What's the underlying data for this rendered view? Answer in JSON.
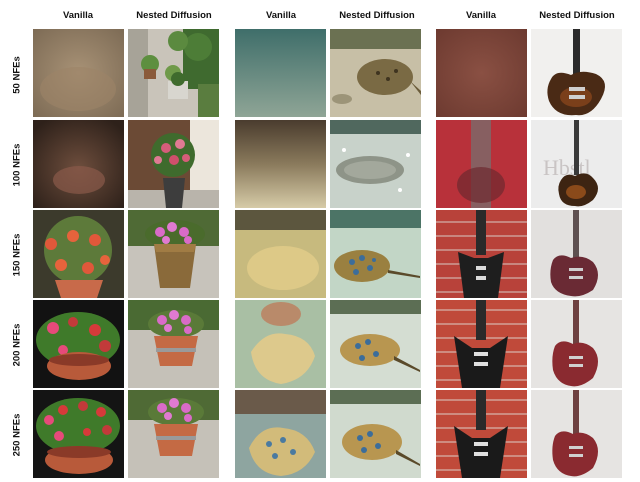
{
  "columns": [
    "Vanilla",
    "Nested Diffusion",
    "Vanilla",
    "Nested Diffusion",
    "Vanilla",
    "Nested Diffusion"
  ],
  "rows": [
    "50 NFEs",
    "100 NFEs",
    "150 NFEs",
    "200 NFEs",
    "250 NFEs"
  ],
  "groups": [
    "flower-pot",
    "stingray",
    "guitar"
  ]
}
